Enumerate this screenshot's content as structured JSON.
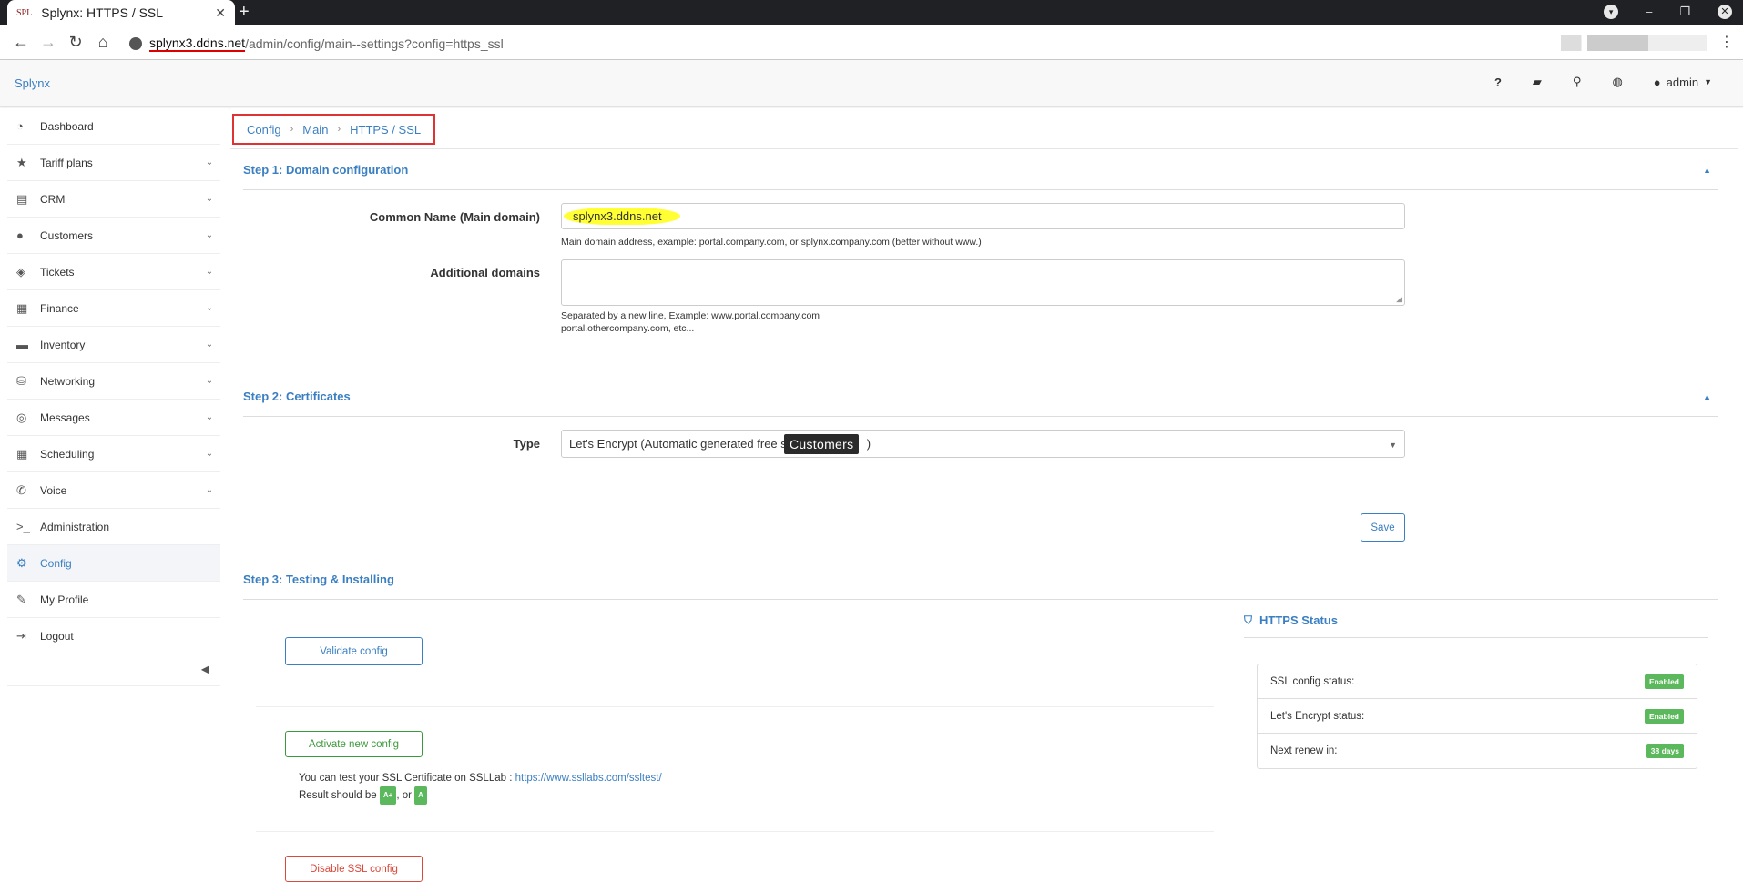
{
  "browser": {
    "tab_favicon": "SPL",
    "tab_title": "Splynx: HTTPS / SSL",
    "url_host": "splynx3.ddns.net",
    "url_path": "/admin/config/main--settings?config=https_ssl"
  },
  "header": {
    "brand": "Splynx",
    "icons": [
      "help-icon",
      "book-icon",
      "search-icon",
      "globe-icon"
    ],
    "user_label": "admin"
  },
  "sidebar": {
    "items": [
      {
        "label": "Dashboard",
        "icon": "dashboard-icon",
        "chevron": false
      },
      {
        "label": "Tariff plans",
        "icon": "star-icon",
        "chevron": true
      },
      {
        "label": "CRM",
        "icon": "crm-icon",
        "chevron": true
      },
      {
        "label": "Customers",
        "icon": "user-icon",
        "chevron": true
      },
      {
        "label": "Tickets",
        "icon": "ticket-icon",
        "chevron": true
      },
      {
        "label": "Finance",
        "icon": "calculator-icon",
        "chevron": true
      },
      {
        "label": "Inventory",
        "icon": "folder-icon",
        "chevron": true
      },
      {
        "label": "Networking",
        "icon": "network-icon",
        "chevron": true
      },
      {
        "label": "Messages",
        "icon": "messages-icon",
        "chevron": true
      },
      {
        "label": "Scheduling",
        "icon": "calendar-icon",
        "chevron": true
      },
      {
        "label": "Voice",
        "icon": "phone-icon",
        "chevron": true
      },
      {
        "label": "Administration",
        "icon": "terminal-icon",
        "chevron": false
      },
      {
        "label": "Config",
        "icon": "cogs-icon",
        "chevron": false,
        "active": true
      },
      {
        "label": "My Profile",
        "icon": "pencil-icon",
        "chevron": false
      },
      {
        "label": "Logout",
        "icon": "logout-icon",
        "chevron": false
      }
    ]
  },
  "breadcrumb": {
    "items": [
      "Config",
      "Main",
      "HTTPS / SSL"
    ]
  },
  "step1": {
    "title": "Step 1: Domain configuration",
    "common_name_label": "Common Name (Main domain)",
    "common_name_value": "splynx3.ddns.net",
    "common_name_help": "Main domain address, example: portal.company.com, or splynx.company.com (better without www.)",
    "additional_label": "Additional domains",
    "additional_value": "",
    "additional_help_1": "Separated by a new line, Example: www.portal.company.com",
    "additional_help_2": "portal.othercompany.com, etc..."
  },
  "step2": {
    "title": "Step 2: Certificates",
    "type_label": "Type",
    "type_value_before": "Let's Encrypt (Automatic generated free s",
    "type_value_after": ")",
    "tooltip": "Customers",
    "save_label": "Save"
  },
  "step3": {
    "title": "Step 3: Testing & Installing",
    "validate_label": "Validate config",
    "activate_label": "Activate new config",
    "ssl_test_text": "You can test your SSL Certificate on SSLLab :",
    "ssl_test_link": "https://www.ssllabs.com/ssltest/",
    "result_text": "Result should be",
    "result_badge_1": "A+",
    "result_or": ", or",
    "result_badge_2": "A",
    "disable_label": "Disable SSL config"
  },
  "https_status": {
    "title": "HTTPS Status",
    "rows": [
      {
        "label": "SSL config status:",
        "value": "Enabled"
      },
      {
        "label": "Let's Encrypt status:",
        "value": "Enabled"
      },
      {
        "label": "Next renew in:",
        "value": "38 days"
      }
    ]
  },
  "colors": {
    "accent": "#3a7fc2",
    "success": "#5cb85c",
    "danger": "#d84a3c",
    "highlight": "#ffff33"
  }
}
